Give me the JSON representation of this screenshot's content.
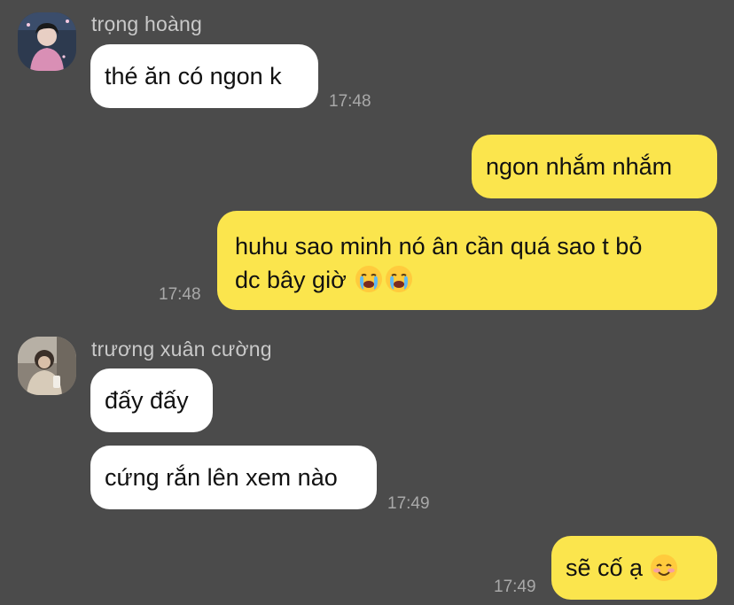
{
  "messages": {
    "m1": {
      "sender": "trọng hoàng",
      "text": "thé ăn có ngon k",
      "time": "17:48"
    },
    "m2": {
      "text": "ngon nhắm nhắm"
    },
    "m3": {
      "text_line1": "huhu sao minh nó ân cần quá sao t bỏ",
      "text_line2": "dc bây giờ",
      "emojis": [
        "loudly-crying-face-icon",
        "loudly-crying-face-icon"
      ],
      "time": "17:48"
    },
    "m4": {
      "sender": "trương xuân cường",
      "text": "đấy đấy"
    },
    "m5": {
      "text": "cứng rắn lên xem nào",
      "time": "17:49"
    },
    "m6": {
      "text": "sẽ cố ạ",
      "emoji": "smiling-face-icon",
      "time": "17:49"
    }
  },
  "colors": {
    "background": "#4b4b4b",
    "incoming_bubble": "#ffffff",
    "outgoing_bubble": "#fbe54d",
    "sender_name": "#c9c9c9",
    "timestamp": "#a9a9a9"
  }
}
